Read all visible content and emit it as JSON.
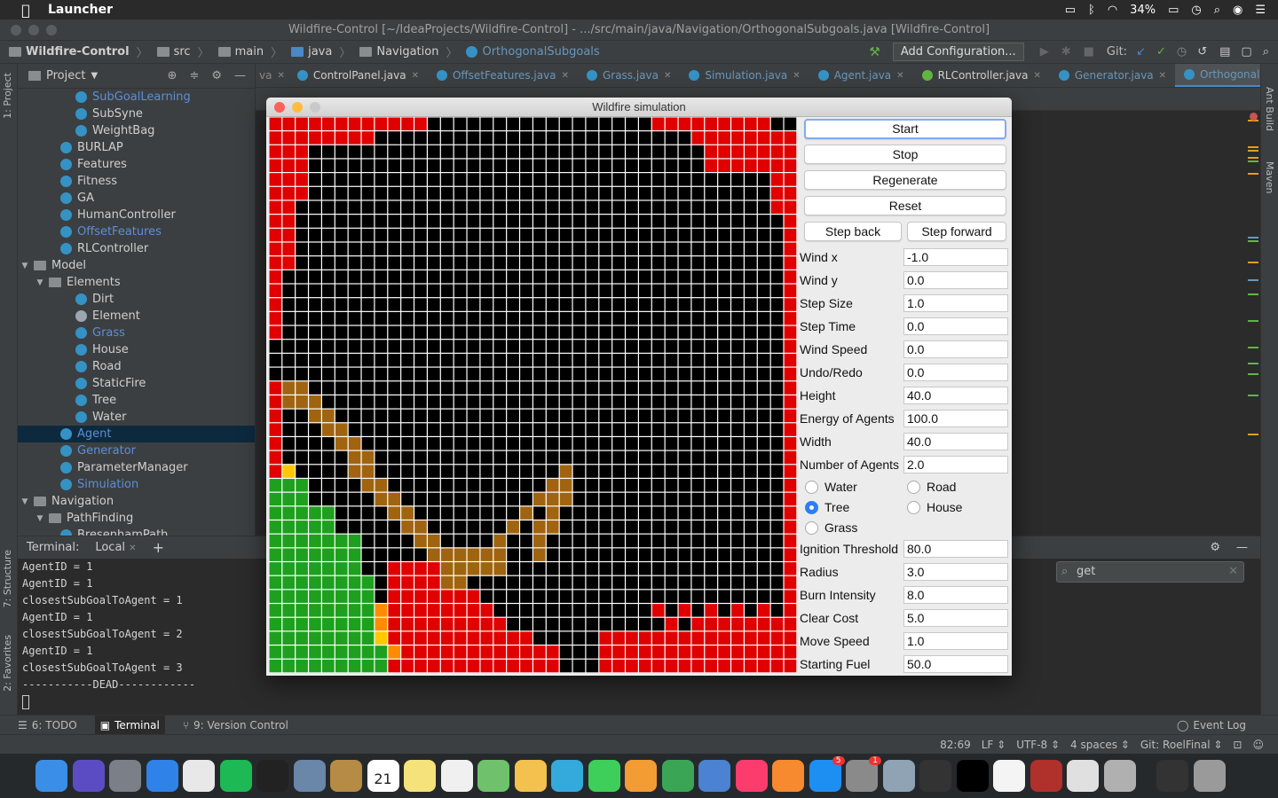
{
  "menubar": {
    "app_name": "Launcher",
    "battery": "34%"
  },
  "window": {
    "title": "Wildfire-Control [~/IdeaProjects/Wildfire-Control] - .../src/main/java/Navigation/OrthogonalSubgoals.java [Wildfire-Control]"
  },
  "navbar": {
    "crumbs": [
      "Wildfire-Control",
      "src",
      "main",
      "java",
      "Navigation",
      "OrthogonalSubgoals"
    ],
    "add_configuration": "Add Configuration...",
    "git_label": "Git:"
  },
  "left_tabs": {
    "project": "1: Project",
    "structure": "7: Structure",
    "favorites": "2: Favorites"
  },
  "right_tabs": {
    "ant": "Ant Build",
    "maven": "Maven"
  },
  "project": {
    "header": "Project",
    "items": [
      {
        "label": "SubGoalLearning",
        "indent": 3,
        "kind": "class",
        "modified": true
      },
      {
        "label": "SubSyne",
        "indent": 3,
        "kind": "class",
        "modified": false
      },
      {
        "label": "WeightBag",
        "indent": 3,
        "kind": "class",
        "modified": false
      },
      {
        "label": "BURLAP",
        "indent": 2,
        "kind": "class",
        "modified": false
      },
      {
        "label": "Features",
        "indent": 2,
        "kind": "class",
        "modified": false
      },
      {
        "label": "Fitness",
        "indent": 2,
        "kind": "class",
        "modified": false
      },
      {
        "label": "GA",
        "indent": 2,
        "kind": "class",
        "modified": false
      },
      {
        "label": "HumanController",
        "indent": 2,
        "kind": "class",
        "modified": false
      },
      {
        "label": "OffsetFeatures",
        "indent": 2,
        "kind": "class",
        "modified": true
      },
      {
        "label": "RLController",
        "indent": 2,
        "kind": "class",
        "modified": false
      },
      {
        "label": "Model",
        "indent": 0,
        "kind": "folder",
        "modified": false
      },
      {
        "label": "Elements",
        "indent": 1,
        "kind": "folder",
        "modified": false
      },
      {
        "label": "Dirt",
        "indent": 3,
        "kind": "class",
        "modified": false
      },
      {
        "label": "Element",
        "indent": 3,
        "kind": "iface",
        "modified": false
      },
      {
        "label": "Grass",
        "indent": 3,
        "kind": "class",
        "modified": true
      },
      {
        "label": "House",
        "indent": 3,
        "kind": "class",
        "modified": false
      },
      {
        "label": "Road",
        "indent": 3,
        "kind": "class",
        "modified": false
      },
      {
        "label": "StaticFire",
        "indent": 3,
        "kind": "class",
        "modified": false
      },
      {
        "label": "Tree",
        "indent": 3,
        "kind": "class",
        "modified": false
      },
      {
        "label": "Water",
        "indent": 3,
        "kind": "class",
        "modified": false
      },
      {
        "label": "Agent",
        "indent": 2,
        "kind": "class",
        "modified": true,
        "selected": true
      },
      {
        "label": "Generator",
        "indent": 2,
        "kind": "class",
        "modified": true
      },
      {
        "label": "ParameterManager",
        "indent": 2,
        "kind": "class",
        "modified": false
      },
      {
        "label": "Simulation",
        "indent": 2,
        "kind": "class",
        "modified": true
      },
      {
        "label": "Navigation",
        "indent": 0,
        "kind": "folder",
        "modified": false
      },
      {
        "label": "PathFinding",
        "indent": 1,
        "kind": "folder",
        "modified": false
      },
      {
        "label": "BresenhamPath",
        "indent": 2,
        "kind": "class",
        "modified": false
      }
    ]
  },
  "tabs": [
    {
      "label": "ControlPanel.java",
      "kind": "class",
      "active": false,
      "modified": false
    },
    {
      "label": "OffsetFeatures.java",
      "kind": "class",
      "active": false,
      "modified": true
    },
    {
      "label": "Grass.java",
      "kind": "class",
      "active": false,
      "modified": true
    },
    {
      "label": "Simulation.java",
      "kind": "class",
      "active": false,
      "modified": true
    },
    {
      "label": "Agent.java",
      "kind": "class",
      "active": false,
      "modified": true
    },
    {
      "label": "RLController.java",
      "kind": "rl",
      "active": false,
      "modified": false
    },
    {
      "label": "Generator.java",
      "kind": "class",
      "active": false,
      "modified": true
    },
    {
      "label": "OrthogonalSubgoals.java",
      "kind": "class",
      "active": true,
      "modified": true
    }
  ],
  "terminal": {
    "label": "Terminal:",
    "tab": "Local",
    "search_value": "get",
    "lines": [
      "AgentID = 1",
      "AgentID = 1",
      "closestSubGoalToAgent = 1",
      "AgentID = 1",
      "closestSubGoalToAgent = 2",
      "AgentID = 1",
      "closestSubGoalToAgent = 3",
      "-----------DEAD------------"
    ]
  },
  "toolwindows": {
    "todo": "6: TODO",
    "terminal": "Terminal",
    "vcs": "9: Version Control",
    "event_log": "Event Log"
  },
  "status": {
    "position": "82:69",
    "line_sep": "LF",
    "encoding": "UTF-8",
    "indent": "4 spaces",
    "git": "Git: RoelFinal"
  },
  "dock": {
    "calendar_day": "21",
    "badge_appstore": "5",
    "badge_prefs": "1"
  },
  "sim": {
    "title": "Wildfire simulation",
    "buttons": {
      "start": "Start",
      "stop": "Stop",
      "regenerate": "Regenerate",
      "reset": "Reset",
      "step_back": "Step back",
      "step_forward": "Step forward"
    },
    "params_top": [
      {
        "label": "Wind x",
        "value": "-1.0"
      },
      {
        "label": "Wind y",
        "value": "0.0"
      },
      {
        "label": "Step Size",
        "value": "1.0"
      },
      {
        "label": "Step Time",
        "value": "0.0"
      },
      {
        "label": "Wind Speed",
        "value": "0.0"
      },
      {
        "label": "Undo/Redo",
        "value": "0.0"
      },
      {
        "label": "Height",
        "value": "40.0"
      },
      {
        "label": "Energy of Agents",
        "value": "100.0"
      },
      {
        "label": "Width",
        "value": "40.0"
      },
      {
        "label": "Number of Agents",
        "value": "2.0"
      }
    ],
    "radios": [
      {
        "label": "Water",
        "selected": false
      },
      {
        "label": "Road",
        "selected": false
      },
      {
        "label": "Tree",
        "selected": true
      },
      {
        "label": "House",
        "selected": false
      },
      {
        "label": "Grass",
        "selected": false
      }
    ],
    "params_bottom": [
      {
        "label": "Ignition Threshold",
        "value": "80.0"
      },
      {
        "label": "Radius",
        "value": "3.0"
      },
      {
        "label": "Burn Intensity",
        "value": "8.0"
      },
      {
        "label": "Clear Cost",
        "value": "5.0"
      },
      {
        "label": "Move Speed",
        "value": "1.0"
      },
      {
        "label": "Starting Fuel",
        "value": "50.0"
      }
    ],
    "grid": {
      "cols": 40,
      "rows": 40,
      "colors": {
        "burnt": "#000000",
        "fire": "#e00000",
        "tree": "#1ea01e",
        "dirt": "#a06410",
        "ember": "#ff8c00",
        "spark": "#ffc800"
      }
    }
  }
}
